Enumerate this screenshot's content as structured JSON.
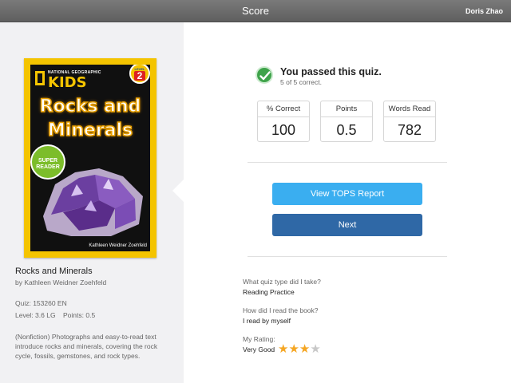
{
  "header": {
    "title": "Score",
    "user": "Doris Zhao"
  },
  "book": {
    "cover": {
      "publisher": "NATIONAL GEOGRAPHIC",
      "brand": "KIDS",
      "level_word": "LEVEL",
      "level_num": "2",
      "title_line1": "Rocks and",
      "title_line2": "Minerals",
      "badge": "SUPER READER",
      "author": "Kathleen Weidner Zoehfeld"
    },
    "title": "Rocks and Minerals",
    "byline": "by Kathleen Weidner Zoehfeld",
    "quiz": "Quiz: 153260 EN",
    "level_points": "Level: 3.6 LG    Points: 0.5",
    "description": "(Nonfiction) Photographs and easy-to-read text introduce rocks and minerals, covering the rock cycle, fossils, gemstones, and rock types."
  },
  "result": {
    "headline": "You passed this quiz.",
    "subline": "5 of 5 correct."
  },
  "stats": [
    {
      "label": "% Correct",
      "value": "100"
    },
    {
      "label": "Points",
      "value": "0.5"
    },
    {
      "label": "Words Read",
      "value": "782"
    }
  ],
  "buttons": {
    "tops": "View TOPS Report",
    "next": "Next"
  },
  "questions": [
    {
      "q": "What quiz type did I take?",
      "a": "Reading Practice"
    },
    {
      "q": "How did I read the book?",
      "a": "I read by myself"
    }
  ],
  "rating": {
    "label": "My Rating:",
    "value": "Very Good",
    "stars_filled": 3,
    "stars_total": 4
  },
  "colors": {
    "star_on": "#f5a623",
    "star_off": "#c8c8c8",
    "tops_button": "#3aaef0",
    "next_button": "#2f68a6",
    "check": "#3ea34a"
  }
}
